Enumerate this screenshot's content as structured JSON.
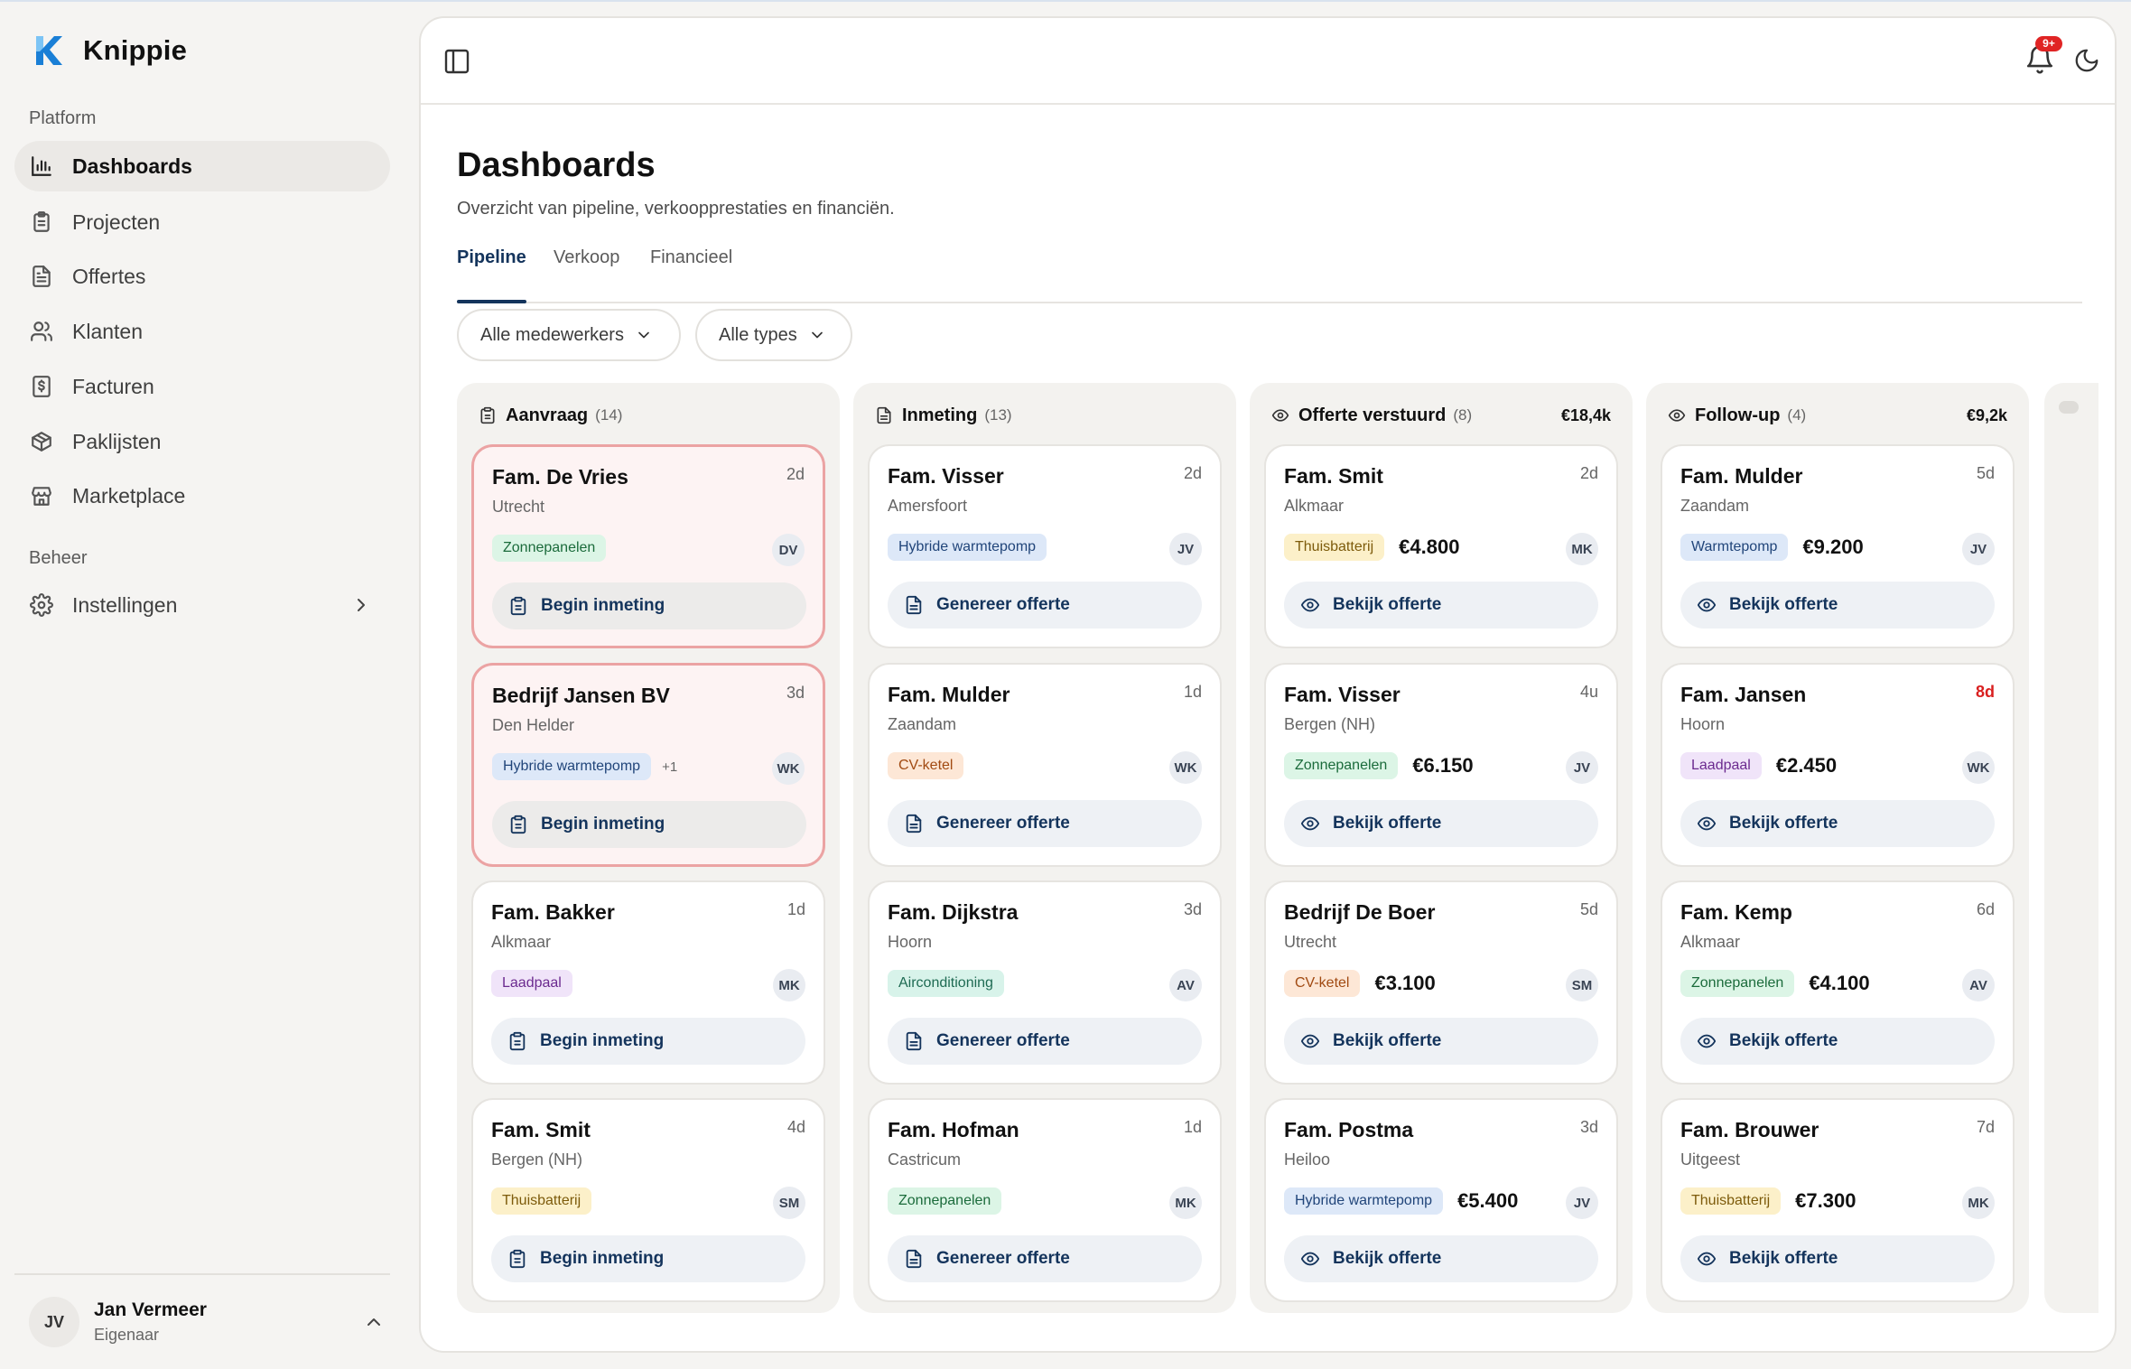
{
  "app": {
    "name": "Knippie"
  },
  "sidebar": {
    "section_platform": "Platform",
    "section_beheer": "Beheer",
    "items": [
      {
        "label": "Dashboards",
        "icon": "bar-chart-icon"
      },
      {
        "label": "Projecten",
        "icon": "clipboard-icon"
      },
      {
        "label": "Offertes",
        "icon": "document-icon"
      },
      {
        "label": "Klanten",
        "icon": "users-icon"
      },
      {
        "label": "Facturen",
        "icon": "receipt-icon"
      },
      {
        "label": "Paklijsten",
        "icon": "package-icon"
      },
      {
        "label": "Marketplace",
        "icon": "store-icon"
      }
    ],
    "settings": {
      "label": "Instellingen",
      "icon": "gear-icon"
    },
    "user": {
      "initials": "JV",
      "name": "Jan Vermeer",
      "role": "Eigenaar"
    }
  },
  "header": {
    "notification_badge": "9+"
  },
  "page": {
    "title": "Dashboards",
    "subtitle": "Overzicht van pipeline, verkoopprestaties en financiën.",
    "tabs": [
      "Pipeline",
      "Verkoop",
      "Financieel"
    ],
    "active_tab": "Pipeline",
    "filters": [
      "Alle medewerkers",
      "Alle types"
    ]
  },
  "colors": {
    "accent": "#14345c",
    "urgent_border": "#eba3a3",
    "urgent_bg": "#fdf3f3",
    "late_text": "#d92020",
    "badge": "#e02424"
  },
  "columns": [
    {
      "title": "Aanvraag",
      "count": "(14)",
      "total": "",
      "icon": "clipboard-icon",
      "cards": [
        {
          "name": "Fam. De Vries",
          "city": "Utrecht",
          "age": "2d",
          "tag": "Zonnepanelen",
          "tag_color": "green",
          "extra": "",
          "price": "",
          "initials": "DV",
          "action": "Begin inmeting",
          "urgent": true
        },
        {
          "name": "Bedrijf Jansen BV",
          "city": "Den Helder",
          "age": "3d",
          "tag": "Hybride warmtepomp",
          "tag_color": "blue",
          "extra": "+1",
          "price": "",
          "initials": "WK",
          "action": "Begin inmeting",
          "urgent": true
        },
        {
          "name": "Fam. Bakker",
          "city": "Alkmaar",
          "age": "1d",
          "tag": "Laadpaal",
          "tag_color": "purple",
          "extra": "",
          "price": "",
          "initials": "MK",
          "action": "Begin inmeting"
        },
        {
          "name": "Fam. Smit",
          "city": "Bergen (NH)",
          "age": "4d",
          "tag": "Thuisbatterij",
          "tag_color": "yellow",
          "extra": "",
          "price": "",
          "initials": "SM",
          "action": "Begin inmeting"
        }
      ]
    },
    {
      "title": "Inmeting",
      "count": "(13)",
      "total": "",
      "icon": "document-icon",
      "cards": [
        {
          "name": "Fam. Visser",
          "city": "Amersfoort",
          "age": "2d",
          "tag": "Hybride warmtepomp",
          "tag_color": "blue",
          "extra": "",
          "price": "",
          "initials": "JV",
          "action": "Genereer offerte"
        },
        {
          "name": "Fam. Mulder",
          "city": "Zaandam",
          "age": "1d",
          "tag": "CV-ketel",
          "tag_color": "orange",
          "extra": "",
          "price": "",
          "initials": "WK",
          "action": "Genereer offerte"
        },
        {
          "name": "Fam. Dijkstra",
          "city": "Hoorn",
          "age": "3d",
          "tag": "Airconditioning",
          "tag_color": "teal",
          "extra": "",
          "price": "",
          "initials": "AV",
          "action": "Genereer offerte"
        },
        {
          "name": "Fam. Hofman",
          "city": "Castricum",
          "age": "1d",
          "tag": "Zonnepanelen",
          "tag_color": "green",
          "extra": "",
          "price": "",
          "initials": "MK",
          "action": "Genereer offerte"
        }
      ]
    },
    {
      "title": "Offerte verstuurd",
      "count": "(8)",
      "total": "€18,4k",
      "icon": "eye-icon",
      "cards": [
        {
          "name": "Fam. Smit",
          "city": "Alkmaar",
          "age": "2d",
          "tag": "Thuisbatterij",
          "tag_color": "yellow",
          "extra": "",
          "price": "€4.800",
          "initials": "MK",
          "action": "Bekijk offerte"
        },
        {
          "name": "Fam. Visser",
          "city": "Bergen (NH)",
          "age": "4u",
          "tag": "Zonnepanelen",
          "tag_color": "green",
          "extra": "",
          "price": "€6.150",
          "initials": "JV",
          "action": "Bekijk offerte"
        },
        {
          "name": "Bedrijf De Boer",
          "city": "Utrecht",
          "age": "5d",
          "tag": "CV-ketel",
          "tag_color": "orange",
          "extra": "",
          "price": "€3.100",
          "initials": "SM",
          "action": "Bekijk offerte"
        },
        {
          "name": "Fam. Postma",
          "city": "Heiloo",
          "age": "3d",
          "tag": "Hybride warmtepomp",
          "tag_color": "blue",
          "extra": "",
          "price": "€5.400",
          "initials": "JV",
          "action": "Bekijk offerte"
        }
      ]
    },
    {
      "title": "Follow-up",
      "count": "(4)",
      "total": "€9,2k",
      "icon": "eye-icon",
      "cards": [
        {
          "name": "Fam. Mulder",
          "city": "Zaandam",
          "age": "5d",
          "tag": "Warmtepomp",
          "tag_color": "blue",
          "extra": "",
          "price": "€9.200",
          "initials": "JV",
          "action": "Bekijk offerte"
        },
        {
          "name": "Fam. Jansen",
          "city": "Hoorn",
          "age": "8d",
          "late": true,
          "tag": "Laadpaal",
          "tag_color": "purple",
          "extra": "",
          "price": "€2.450",
          "initials": "WK",
          "action": "Bekijk offerte"
        },
        {
          "name": "Fam. Kemp",
          "city": "Alkmaar",
          "age": "6d",
          "tag": "Zonnepanelen",
          "tag_color": "green",
          "extra": "",
          "price": "€4.100",
          "initials": "AV",
          "action": "Bekijk offerte"
        },
        {
          "name": "Fam. Brouwer",
          "city": "Uitgeest",
          "age": "7d",
          "tag": "Thuisbatterij",
          "tag_color": "yellow",
          "extra": "",
          "price": "€7.300",
          "initials": "MK",
          "action": "Bekijk offerte"
        }
      ]
    }
  ]
}
